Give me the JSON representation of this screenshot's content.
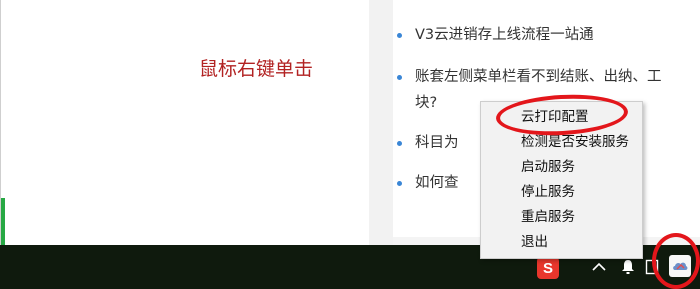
{
  "annotation": {
    "instruction": "鼠标右键单击"
  },
  "article": {
    "items": [
      {
        "text": "V3云进销存上线流程一站通"
      },
      {
        "text": "账套左侧菜单栏看不到结账、出纳、工",
        "text_cont": "块?"
      },
      {
        "text": "科目为"
      },
      {
        "text": "如何查"
      }
    ]
  },
  "context_menu": {
    "items": [
      {
        "label": "云打印配置"
      },
      {
        "label": "检测是否安装服务"
      },
      {
        "label": "启动服务"
      },
      {
        "label": "停止服务"
      },
      {
        "label": "重启服务"
      },
      {
        "label": "退出"
      }
    ]
  },
  "taskbar": {
    "sogou_label": "S",
    "icons": [
      "sogou-ime-icon",
      "chevron-up-icon",
      "notification-bell-icon",
      "tray-app-icon",
      "cloud-print-icon"
    ]
  },
  "colors": {
    "instruction": "#b22222",
    "highlight": "#e3161b",
    "bullet": "#3a86d6",
    "taskbar": "#0f1a0d"
  }
}
